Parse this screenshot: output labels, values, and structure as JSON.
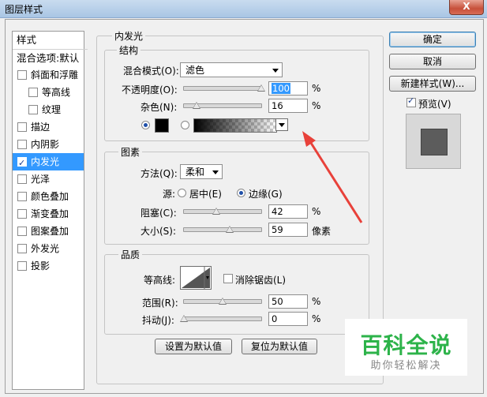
{
  "window": {
    "title": "图层样式",
    "close_label": "X"
  },
  "style_list": {
    "header": "样式",
    "blend_options": "混合选项:默认",
    "items": [
      {
        "label": "斜面和浮雕",
        "checked": false,
        "indent": false
      },
      {
        "label": "等高线",
        "checked": false,
        "indent": true
      },
      {
        "label": "纹理",
        "checked": false,
        "indent": true
      },
      {
        "label": "描边",
        "checked": false,
        "indent": false
      },
      {
        "label": "内阴影",
        "checked": false,
        "indent": false
      },
      {
        "label": "内发光",
        "checked": true,
        "indent": false,
        "selected": true
      },
      {
        "label": "光泽",
        "checked": false,
        "indent": false
      },
      {
        "label": "颜色叠加",
        "checked": false,
        "indent": false
      },
      {
        "label": "渐变叠加",
        "checked": false,
        "indent": false
      },
      {
        "label": "图案叠加",
        "checked": false,
        "indent": false
      },
      {
        "label": "外发光",
        "checked": false,
        "indent": false
      },
      {
        "label": "投影",
        "checked": false,
        "indent": false
      }
    ]
  },
  "panel": {
    "title": "内发光",
    "structure": {
      "legend": "结构",
      "blend_mode_label": "混合模式(O):",
      "blend_mode_value": "滤色",
      "opacity_label": "不透明度(O):",
      "opacity_value": "100",
      "opacity_level": 100,
      "noise_label": "杂色(N):",
      "noise_value": "16",
      "noise_level": 16,
      "percent": "%"
    },
    "elements": {
      "legend": "图素",
      "method_label": "方法(Q):",
      "method_value": "柔和",
      "source_label": "源:",
      "source_center": "居中(E)",
      "source_edge": "边缘(G)",
      "choke_label": "阻塞(C):",
      "choke_value": "42",
      "choke_level": 42,
      "size_label": "大小(S):",
      "size_value": "59",
      "size_level": 59,
      "percent": "%",
      "px": "像素"
    },
    "quality": {
      "legend": "品质",
      "contour_label": "等高线:",
      "antialias_label": "消除锯齿(L)",
      "range_label": "范围(R):",
      "range_value": "50",
      "range_level": 50,
      "jitter_label": "抖动(J):",
      "jitter_value": "0",
      "jitter_level": 0,
      "percent": "%"
    },
    "set_default": "设置为默认值",
    "reset_default": "复位为默认值"
  },
  "right": {
    "ok": "确定",
    "cancel": "取消",
    "new_style": "新建样式(W)...",
    "preview_label": "预览(V)"
  },
  "watermark": {
    "main": "百科全说",
    "sub": "助你轻松解决"
  },
  "colors": {
    "accent": "#3399ff",
    "arrow": "#e8413a",
    "watermark": "#2db34a"
  }
}
